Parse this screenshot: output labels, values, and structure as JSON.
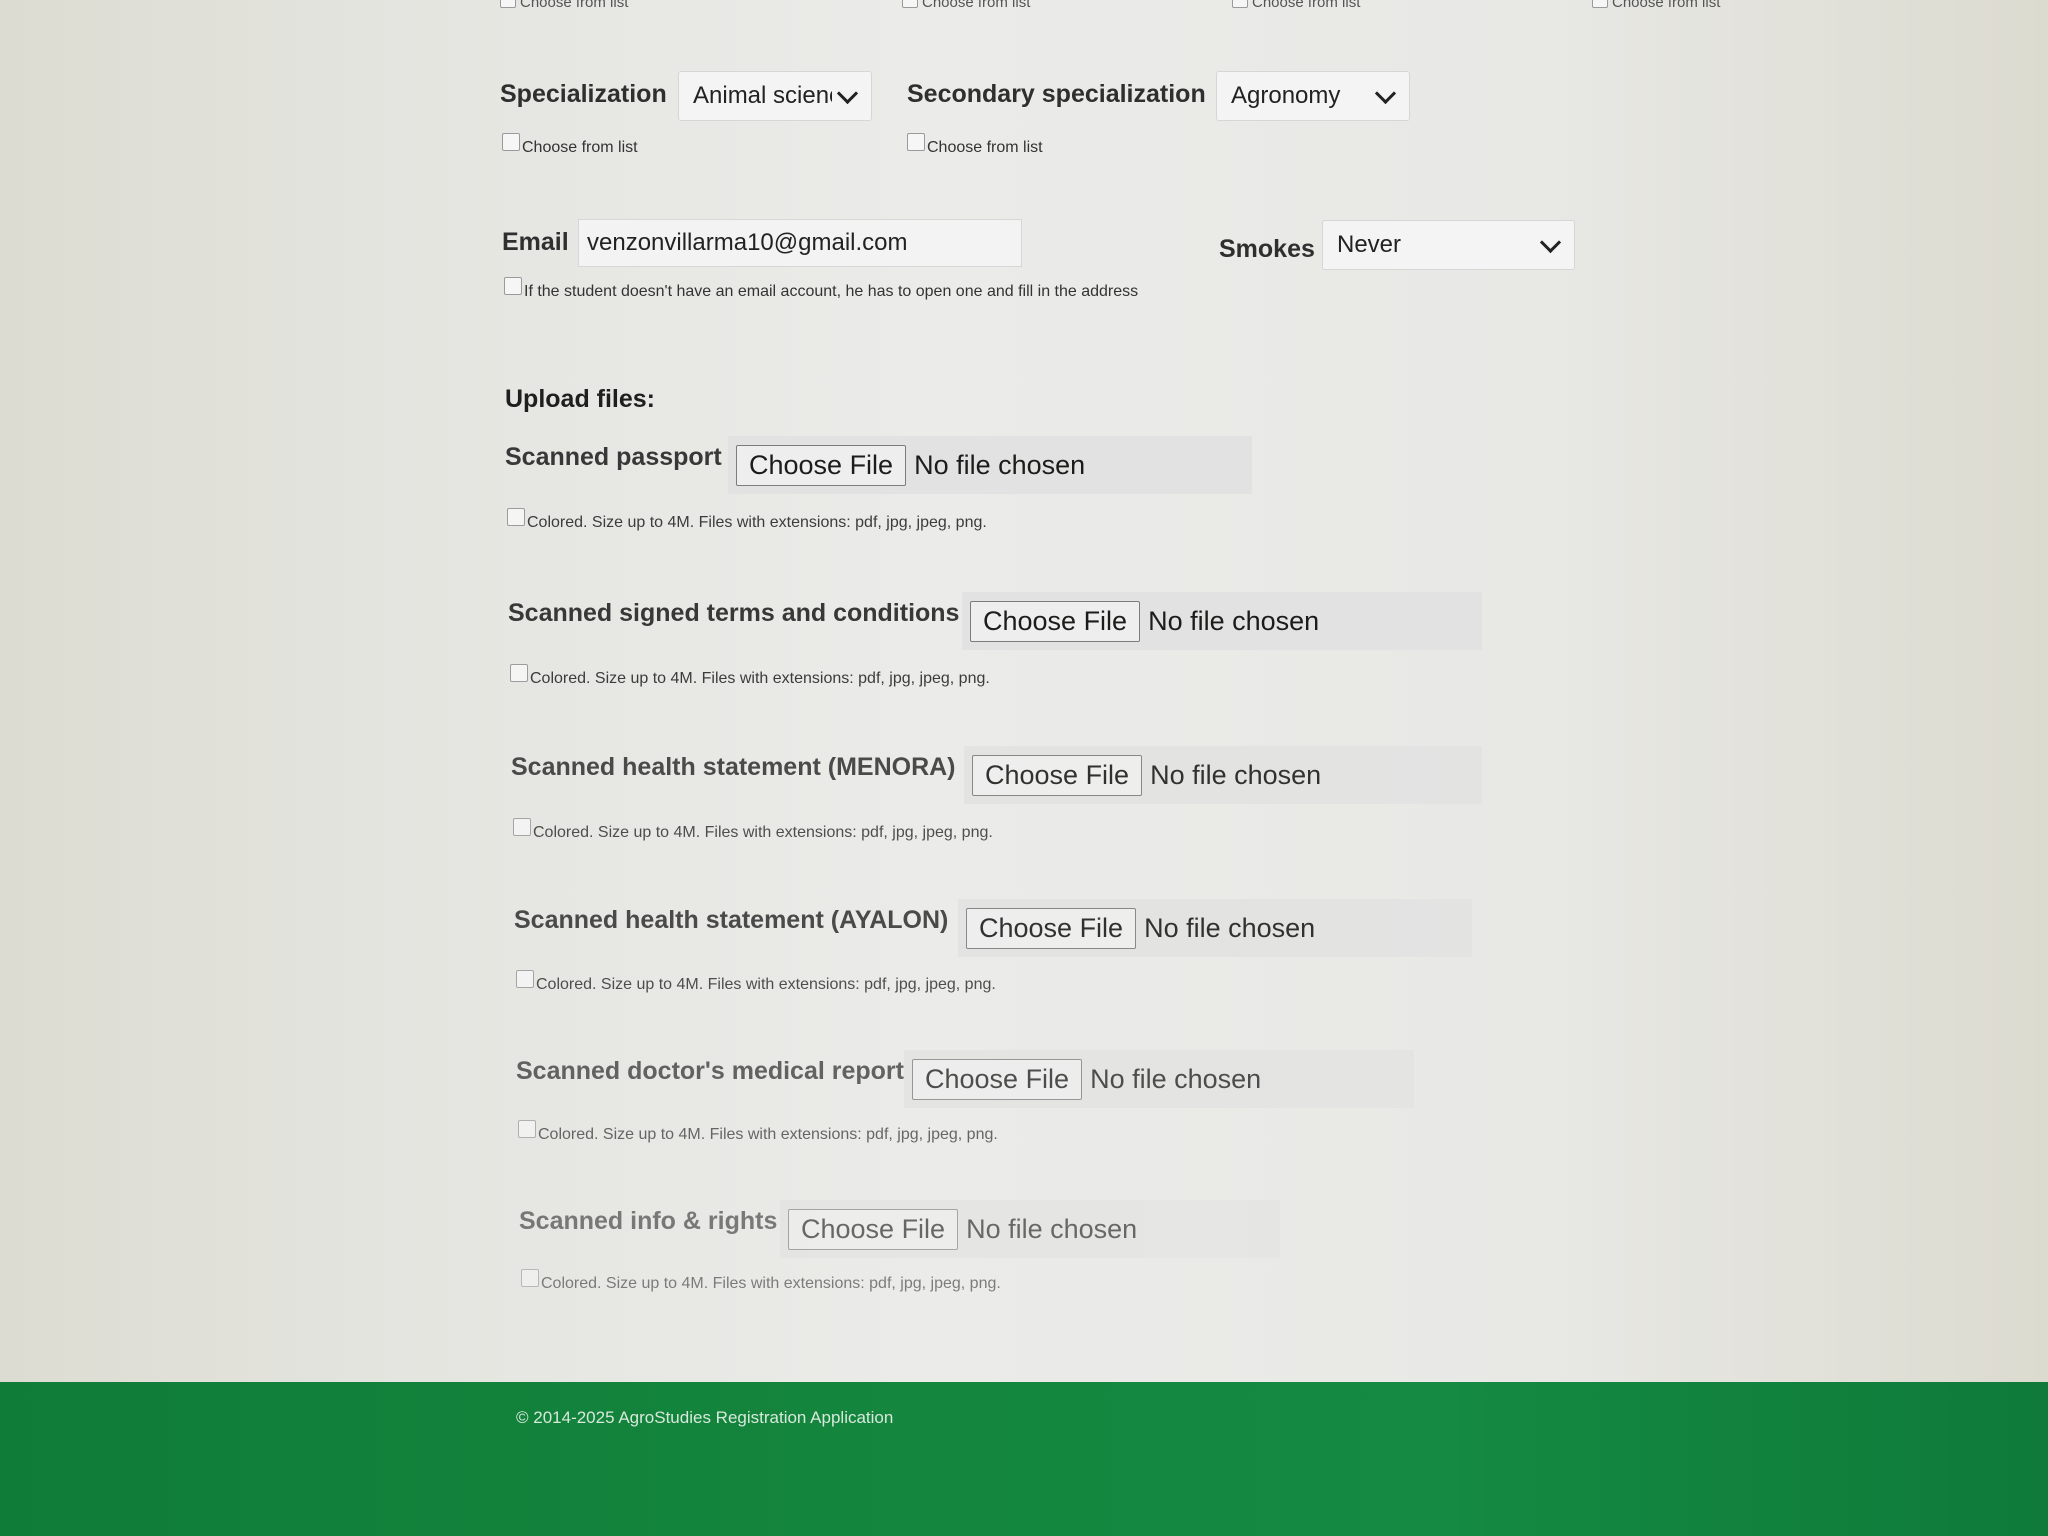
{
  "top_hints": [
    "Choose from list",
    "Choose from list",
    "Choose from list",
    "Choose from list"
  ],
  "specialization": {
    "label": "Specialization",
    "value": "Animal scienc",
    "hint": "Choose from list"
  },
  "secondary_specialization": {
    "label": "Secondary specialization",
    "value": "Agronomy",
    "hint": "Choose from list"
  },
  "email": {
    "label": "Email",
    "value": "venzonvillarma10@gmail.com",
    "hint": "If the student doesn't have an email account, he has to open one and fill in the address"
  },
  "smokes": {
    "label": "Smokes",
    "value": "Never"
  },
  "upload": {
    "title": "Upload files:",
    "files": [
      {
        "label": "Scanned passport",
        "button": "Choose File",
        "status": "No file chosen",
        "hint": "Colored. Size up to 4M. Files with extensions: pdf, jpg, jpeg, png."
      },
      {
        "label": "Scanned signed terms and conditions",
        "button": "Choose File",
        "status": "No file chosen",
        "hint": "Colored. Size up to 4M. Files with extensions: pdf, jpg, jpeg, png."
      },
      {
        "label": "Scanned health statement (MENORA)",
        "button": "Choose File",
        "status": "No file chosen",
        "hint": "Colored. Size up to 4M. Files with extensions: pdf, jpg, jpeg, png."
      },
      {
        "label": "Scanned health statement (AYALON)",
        "button": "Choose File",
        "status": "No file chosen",
        "hint": "Colored. Size up to 4M. Files with extensions: pdf, jpg, jpeg, png."
      },
      {
        "label": "Scanned doctor's medical report",
        "button": "Choose File",
        "status": "No file chosen",
        "hint": "Colored. Size up to 4M. Files with extensions: pdf, jpg, jpeg, png."
      },
      {
        "label": "Scanned info & rights",
        "button": "Choose File",
        "status": "No file chosen",
        "hint": "Colored. Size up to 4M. Files with extensions: pdf, jpg, jpeg, png."
      }
    ]
  },
  "footer": {
    "text": "© 2014-2025 AgroStudies Registration Application"
  },
  "colors": {
    "footer_green": "#14853d",
    "background": "#e8e8e5"
  }
}
